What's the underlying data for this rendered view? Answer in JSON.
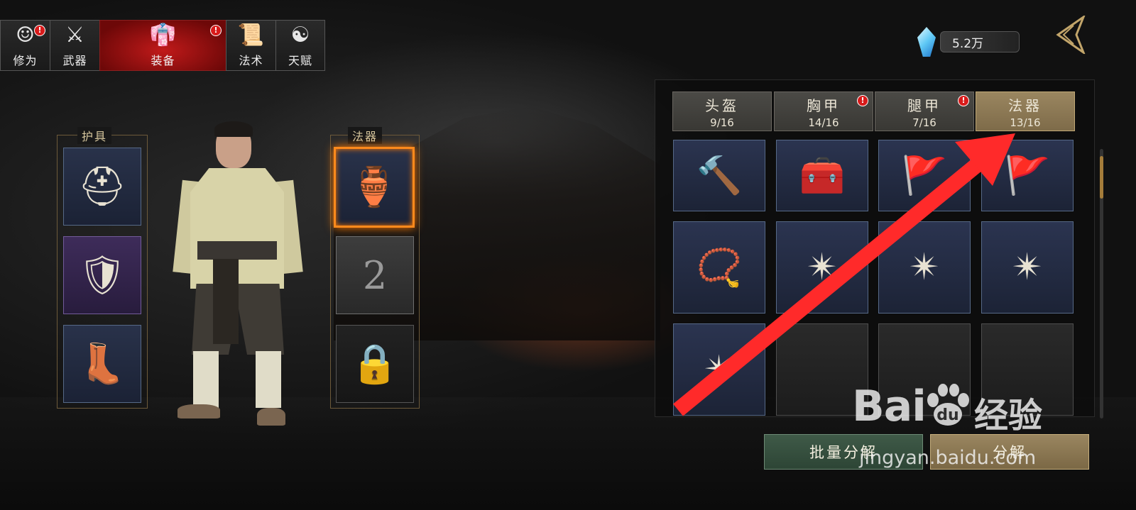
{
  "top_tabs": [
    {
      "label": "修为",
      "icon": "face-icon",
      "glyph": "☺",
      "badge": "!"
    },
    {
      "label": "武器",
      "icon": "sword-icon",
      "glyph": "⚔",
      "badge": ""
    },
    {
      "label": "装备",
      "icon": "robe-icon",
      "glyph": "👘",
      "badge": "!",
      "active": true
    },
    {
      "label": "法术",
      "icon": "scroll-icon",
      "glyph": "📜",
      "badge": ""
    },
    {
      "label": "天赋",
      "icon": "bagua-icon",
      "glyph": "☯",
      "badge": ""
    }
  ],
  "currency": {
    "icon": "crystal-icon",
    "amount": "5.2万"
  },
  "back_icon": "back-chevron-icon",
  "armor_panel": {
    "title": "护具",
    "slots": [
      {
        "name": "helmet-icon",
        "glyph": "⛑"
      },
      {
        "name": "chest-armor-icon",
        "glyph": "🛡"
      },
      {
        "name": "boots-icon",
        "glyph": "👢"
      }
    ]
  },
  "artifact_panel": {
    "title": "法器",
    "slots": [
      {
        "name": "gourd-artifact-icon",
        "glyph": "🏺"
      },
      {
        "name": "ruyi-icon",
        "glyph": "2"
      },
      {
        "name": "lock-icon",
        "glyph": "🔒"
      }
    ]
  },
  "categories": [
    {
      "name": "头盔",
      "count": "9/16",
      "badge": ""
    },
    {
      "name": "胸甲",
      "count": "14/16",
      "badge": "!"
    },
    {
      "name": "腿甲",
      "count": "7/16",
      "badge": "!"
    },
    {
      "name": "法器",
      "count": "13/16",
      "badge": "",
      "active": true
    }
  ],
  "inventory": [
    {
      "name": "seal-stamp-icon",
      "glyph": "🔨"
    },
    {
      "name": "carved-box-icon",
      "glyph": "🧰"
    },
    {
      "name": "banner-flag-icon",
      "glyph": "🚩"
    },
    {
      "name": "banner-flag-icon",
      "glyph": "🚩"
    },
    {
      "name": "talisman-tablet-icon",
      "glyph": "📿"
    },
    {
      "name": "bagua-mirror-icon",
      "glyph": "✴"
    },
    {
      "name": "bagua-mirror-icon",
      "glyph": "✴"
    },
    {
      "name": "bagua-mirror-icon",
      "glyph": "✴"
    },
    {
      "name": "bagua-mirror-icon",
      "glyph": "✴"
    },
    {
      "name": "empty-slot",
      "glyph": ""
    },
    {
      "name": "empty-slot",
      "glyph": ""
    },
    {
      "name": "empty-slot",
      "glyph": ""
    }
  ],
  "buttons": {
    "batch_dismantle": "批量分解",
    "dismantle": "分解"
  },
  "watermark": {
    "logo": "Bai",
    "logo_cn": "经验",
    "url": "jingyan.baidu.com"
  },
  "colors": {
    "accent_red": "#c11a1a",
    "selected_orange": "#ff8a1c",
    "arrow_red": "#ff2a2a",
    "tab_gold": "#9a8660"
  }
}
